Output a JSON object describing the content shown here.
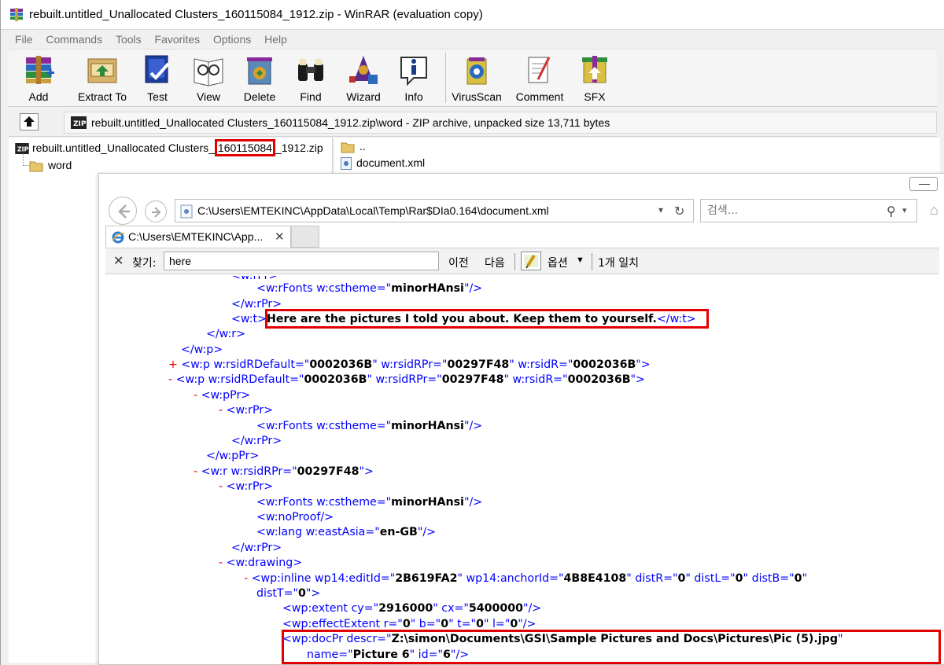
{
  "window": {
    "title": "rebuilt.untitled_Unallocated Clusters_160115084_1912.zip - WinRAR (evaluation copy)"
  },
  "menu": [
    "File",
    "Commands",
    "Tools",
    "Favorites",
    "Options",
    "Help"
  ],
  "toolbar": {
    "add": "Add",
    "extract_to": "Extract To",
    "test": "Test",
    "view": "View",
    "delete": "Delete",
    "find": "Find",
    "wizard": "Wizard",
    "info": "Info",
    "virusscan": "VirusScan",
    "comment": "Comment",
    "sfx": "SFX"
  },
  "pathbar": {
    "text": "rebuilt.untitled_Unallocated Clusters_160115084_1912.zip\\word - ZIP archive, unpacked size 13,711 bytes"
  },
  "tree": {
    "root_prefix": "rebuilt.untitled_Unallocated Clusters_",
    "root_highlight": "160115084",
    "root_suffix": "_1912.zip",
    "child": "word"
  },
  "files": [
    "..",
    "document.xml"
  ],
  "browser": {
    "address": "C:\\Users\\EMTEKINC\\AppData\\Local\\Temp\\Rar$DIa0.164\\document.xml",
    "search_placeholder": "검색...",
    "tab_title": "C:\\Users\\EMTEKINC\\App...",
    "find_label": "찾기:",
    "find_value": "here",
    "find_prev": "이전",
    "find_next": "다음",
    "options": "옵션",
    "match_count": "1개 일치"
  },
  "xml": {
    "l1_fonts": "minorHAnsi",
    "l3_text": "Here are the pictures I told you about. Keep them to yourself.",
    "rsidRDefault": "0002036B",
    "rsidRPr": "00297F48",
    "rsidR": "0002036B",
    "run_rsidRPr": "00297F48",
    "fonts_theme": "minorHAnsi",
    "lang_eastAsia": "en-GB",
    "editId": "2B619FA2",
    "anchorId": "4B8E4108",
    "distR": "0",
    "distL": "0",
    "distB": "0",
    "distT": "0",
    "extent_cy": "2916000",
    "extent_cx": "5400000",
    "eff_r": "0",
    "eff_b": "0",
    "eff_t": "0",
    "eff_l": "0",
    "docPr_descr": "Z:\\simon\\Documents\\GSI\\Sample Pictures and Docs\\Pictures\\Pic (5).jpg",
    "docPr_name": "Picture 6",
    "docPr_id": "6"
  },
  "colors": {
    "highlight_box": "#e00000",
    "xml_tag": "#0000ff",
    "xml_collapse": "#e00000"
  }
}
